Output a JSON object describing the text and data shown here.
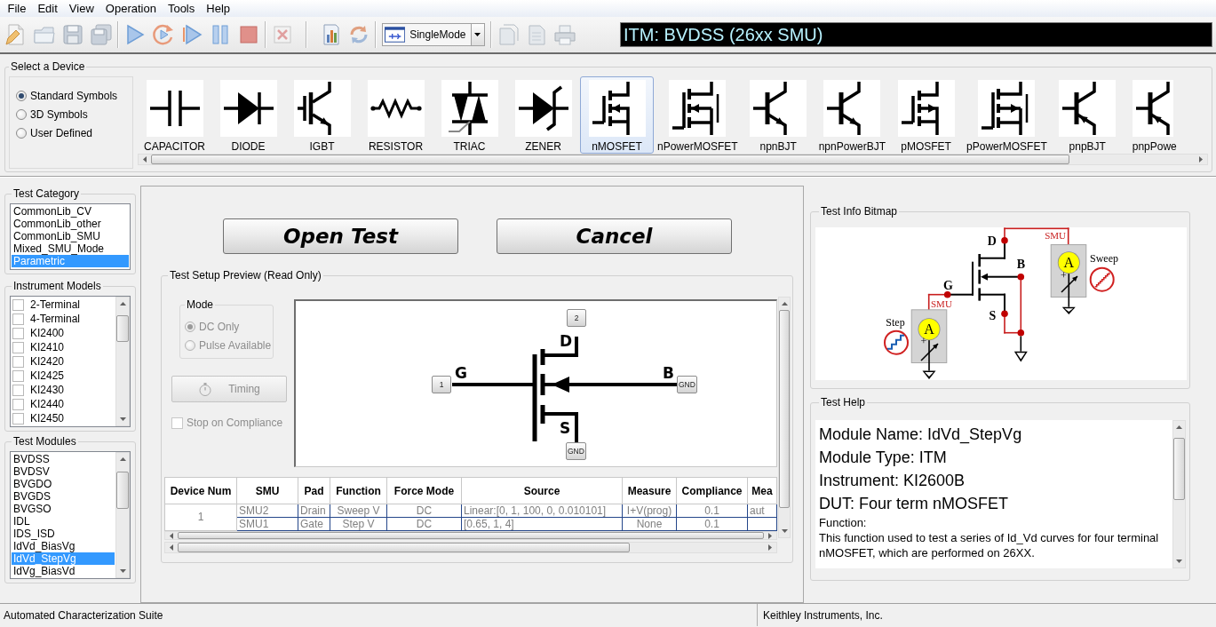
{
  "menu_bar": [
    "File",
    "Edit",
    "View",
    "Operation",
    "Tools",
    "Help"
  ],
  "toolbar": {
    "mode_dropdown": {
      "value": "SingleMode"
    }
  },
  "test_title": "ITM: BVDSS (26xx SMU)",
  "select_device": {
    "title": "Select a Device",
    "symbol_sets": [
      {
        "label": "Standard Symbols",
        "selected": true
      },
      {
        "label": "3D Symbols",
        "selected": false
      },
      {
        "label": "User Defined",
        "selected": false
      }
    ],
    "devices": [
      {
        "kind": "capacitor",
        "label": "CAPACITOR",
        "selected": false
      },
      {
        "kind": "diode",
        "label": "DIODE",
        "selected": false
      },
      {
        "kind": "igbt",
        "label": "IGBT",
        "selected": false
      },
      {
        "kind": "resistor",
        "label": "RESISTOR",
        "selected": false
      },
      {
        "kind": "triac",
        "label": "TRIAC",
        "selected": false
      },
      {
        "kind": "zener",
        "label": "ZENER",
        "selected": false
      },
      {
        "kind": "nmosfet",
        "label": "nMOSFET",
        "selected": true
      },
      {
        "kind": "npowermosfet",
        "label": "nPowerMOSFET",
        "selected": false
      },
      {
        "kind": "npnbjt",
        "label": "npnBJT",
        "selected": false
      },
      {
        "kind": "npnpowerbjt",
        "label": "npnPowerBJT",
        "selected": false
      },
      {
        "kind": "pmosfet",
        "label": "pMOSFET",
        "selected": false
      },
      {
        "kind": "ppowermosfet",
        "label": "pPowerMOSFET",
        "selected": false
      },
      {
        "kind": "pnpbjt",
        "label": "pnpBJT",
        "selected": false
      },
      {
        "kind": "pnppowerbjt",
        "label": "pnpPowe",
        "selected": false
      }
    ]
  },
  "test_category": {
    "title": "Test Category",
    "items": [
      {
        "label": "CommonLib_CV",
        "selected": false
      },
      {
        "label": "CommonLib_other",
        "selected": false
      },
      {
        "label": "CommonLib_SMU",
        "selected": false
      },
      {
        "label": "Mixed_SMU_Mode",
        "selected": false
      },
      {
        "label": "Parametric",
        "selected": true
      }
    ]
  },
  "instrument_models": {
    "title": "Instrument Models",
    "items": [
      {
        "label": "2-Terminal",
        "checked": false
      },
      {
        "label": "4-Terminal",
        "checked": false
      },
      {
        "label": "KI2400",
        "checked": false
      },
      {
        "label": "KI2410",
        "checked": false
      },
      {
        "label": "KI2420",
        "checked": false
      },
      {
        "label": "KI2425",
        "checked": false
      },
      {
        "label": "KI2430",
        "checked": false
      },
      {
        "label": "KI2440",
        "checked": false
      },
      {
        "label": "KI2450",
        "checked": false
      }
    ]
  },
  "test_modules": {
    "title": "Test Modules",
    "items": [
      {
        "label": "BVDSS",
        "selected": false
      },
      {
        "label": "BVDSV",
        "selected": false
      },
      {
        "label": "BVGDO",
        "selected": false
      },
      {
        "label": "BVGDS",
        "selected": false
      },
      {
        "label": "BVGSO",
        "selected": false
      },
      {
        "label": "IDL",
        "selected": false
      },
      {
        "label": "IDS_ISD",
        "selected": false
      },
      {
        "label": "IdVd_BiasVg",
        "selected": false
      },
      {
        "label": "IdVd_StepVg",
        "selected": true
      },
      {
        "label": "IdVg_BiasVd",
        "selected": false
      }
    ]
  },
  "actions": [
    {
      "label": "Open Test"
    },
    {
      "label": "Cancel"
    }
  ],
  "test_setup_preview": {
    "title": "Test Setup Preview (Read Only)",
    "mode": {
      "title": "Mode",
      "disabled": true,
      "options": [
        {
          "label": "DC Only",
          "selected": true
        },
        {
          "label": "Pulse Available",
          "selected": false
        }
      ]
    },
    "timing_button": {
      "label": "Timing",
      "disabled": true
    },
    "stop_on_compliance": {
      "label": "Stop on Compliance",
      "checked": false,
      "disabled": true
    },
    "schematic": {
      "terminals": [
        {
          "name": "D",
          "pad": "2"
        },
        {
          "name": "G",
          "pad": "1"
        },
        {
          "name": "B",
          "pad": "GND"
        },
        {
          "name": "S",
          "pad": "GND"
        }
      ]
    },
    "table": {
      "columns": [
        "Device Num",
        "SMU",
        "Pad",
        "Function",
        "Force Mode",
        "Source",
        "Measure",
        "Compliance",
        "Mea"
      ],
      "groups": [
        {
          "device_num": "1",
          "rows": [
            [
              "SMU2",
              "Drain",
              "Sweep V",
              "DC",
              "Linear:[0, 1, 100, 0, 0.010101]",
              "I+V(prog)",
              "0.1",
              "aut"
            ],
            [
              "SMU1",
              "Gate",
              "Step V",
              "DC",
              "[0.65, 1, 4]",
              "None",
              "0.1"
            ]
          ]
        }
      ]
    }
  },
  "test_info_bitmap": {
    "title": "Test Info Bitmap",
    "terminals": [
      "D",
      "B",
      "G",
      "S"
    ],
    "sources": [
      {
        "kind": "sweep",
        "label": "SMU",
        "meter": "A",
        "sign": "+",
        "waveform_label": "Sweep"
      },
      {
        "kind": "step",
        "label": "SMU",
        "meter": "A",
        "sign": "+",
        "waveform_label": "Step"
      }
    ]
  },
  "test_help": {
    "title": "Test Help",
    "lines": [
      {
        "kind": "heading",
        "text": "Module Name: IdVd_StepVg"
      },
      {
        "kind": "heading",
        "text": "Module Type: ITM"
      },
      {
        "kind": "heading",
        "text": "Instrument: KI2600B"
      },
      {
        "kind": "heading",
        "text": "DUT: Four term nMOSFET"
      },
      {
        "kind": "body",
        "text": "Function:"
      },
      {
        "kind": "body",
        "text": "This function used to test a series of Id_Vd curves for four terminal nMOSFET, which are performed on 26XX."
      }
    ]
  },
  "status_bar": [
    "Automated Characterization Suite",
    "Keithley Instruments, Inc."
  ]
}
